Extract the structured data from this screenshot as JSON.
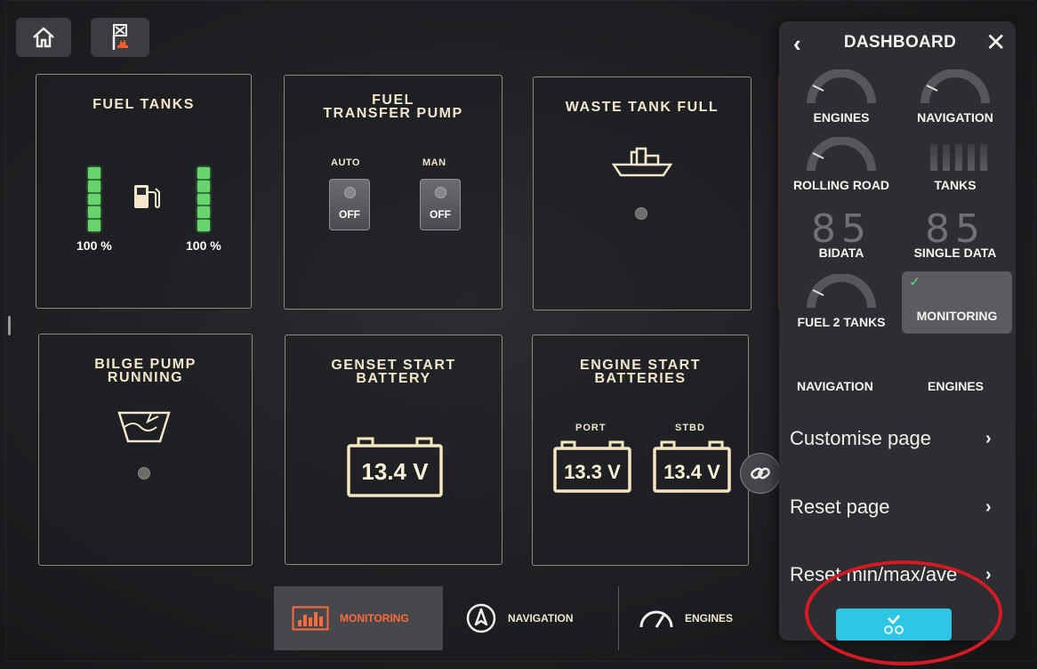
{
  "top_buttons": {
    "home_icon": "home-icon",
    "alarm_icon": "alarm-mute-icon"
  },
  "tiles": {
    "fuel_tanks": {
      "title": "FUEL TANKS",
      "left_pct": "100 %",
      "right_pct": "100 %",
      "left_level": 1.0,
      "right_level": 1.0,
      "icon": "fuel-pump-icon"
    },
    "fuel_transfer_pump": {
      "title_line1": "FUEL",
      "title_line2": "TRANSFER PUMP",
      "auto_label": "AUTO",
      "man_label": "MAN",
      "auto_state": "OFF",
      "man_state": "OFF"
    },
    "waste_tank_full": {
      "title": "WASTE TANK FULL",
      "icon": "boat-tank-icon"
    },
    "bilge_pump_running": {
      "title_line1": "BILGE PUMP",
      "title_line2": "RUNNING",
      "icon": "bilge-icon"
    },
    "genset_start_battery": {
      "title_line1": "GENSET START",
      "title_line2": "BATTERY",
      "voltage": "13.4 V"
    },
    "engine_start_batteries": {
      "title_line1": "ENGINE START",
      "title_line2": "BATTERIES",
      "port_label": "PORT",
      "stbd_label": "STBD",
      "port_voltage": "13.3 V",
      "stbd_voltage": "13.4 V"
    }
  },
  "bottom_nav": [
    {
      "label": "MONITORING",
      "icon": "monitoring-icon",
      "active": true
    },
    {
      "label": "NAVIGATION",
      "icon": "compass-icon",
      "active": false
    },
    {
      "label": "ENGINES",
      "icon": "gauge-icon",
      "active": false
    }
  ],
  "panel": {
    "title": "DASHBOARD",
    "back_icon": "chevron-left-icon",
    "close_icon": "close-icon",
    "items": [
      {
        "label": "ENGINES",
        "selected": false
      },
      {
        "label": "NAVIGATION",
        "selected": false
      },
      {
        "label": "ROLLING ROAD",
        "selected": false
      },
      {
        "label": "TANKS",
        "selected": false
      },
      {
        "label": "BIDATA",
        "preview": "85",
        "selected": false
      },
      {
        "label": "SINGLE DATA",
        "preview": "85",
        "selected": false
      },
      {
        "label": "FUEL 2 TANKS",
        "selected": false
      },
      {
        "label": "MONITORING",
        "selected": true
      }
    ],
    "sub_tabs": [
      "NAVIGATION",
      "ENGINES"
    ],
    "menu": [
      {
        "label": "Customise page"
      },
      {
        "label": "Reset page"
      },
      {
        "label": "Reset min/max/ave"
      }
    ],
    "confirm_icon": "checkmark-icon"
  },
  "colors": {
    "accent_orange": "#ff6a3c",
    "gauge_green": "#69d36d",
    "confirm_cyan": "#2fc6e6",
    "annotation_red": "#d41a24"
  }
}
